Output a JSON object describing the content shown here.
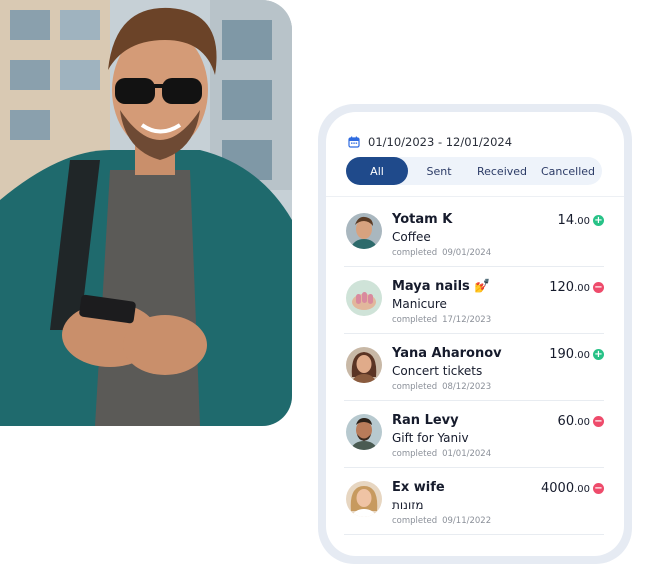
{
  "filter": {
    "icon": "calendar-icon",
    "date_range": "01/10/2023 - 12/01/2024"
  },
  "tabs": [
    {
      "label": "All",
      "active": true
    },
    {
      "label": "Sent",
      "active": false
    },
    {
      "label": "Received",
      "active": false
    },
    {
      "label": "Cancelled",
      "active": false
    }
  ],
  "colors": {
    "accent": "#1f4a8b",
    "income": "#27c287",
    "expense": "#ee4b6b"
  },
  "transactions": [
    {
      "name": "Yotam K",
      "description": "Coffee",
      "status": "completed",
      "date": "09/01/2024",
      "amount_int": "14",
      "amount_dec": ".00",
      "direction": "plus"
    },
    {
      "name": "Maya nails 💅",
      "description": "Manicure",
      "status": "completed",
      "date": "17/12/2023",
      "amount_int": "120",
      "amount_dec": ".00",
      "direction": "minus"
    },
    {
      "name": "Yana Aharonov",
      "description": "Concert tickets",
      "status": "completed",
      "date": "08/12/2023",
      "amount_int": "190",
      "amount_dec": ".00",
      "direction": "plus"
    },
    {
      "name": "Ran Levy",
      "description": "Gift for Yaniv",
      "status": "completed",
      "date": "01/01/2024",
      "amount_int": "60",
      "amount_dec": ".00",
      "direction": "minus"
    },
    {
      "name": "Ex wife",
      "description": "מזונות",
      "status": "completed",
      "date": "09/11/2022",
      "amount_int": "4000",
      "amount_dec": ".00",
      "direction": "minus"
    }
  ]
}
